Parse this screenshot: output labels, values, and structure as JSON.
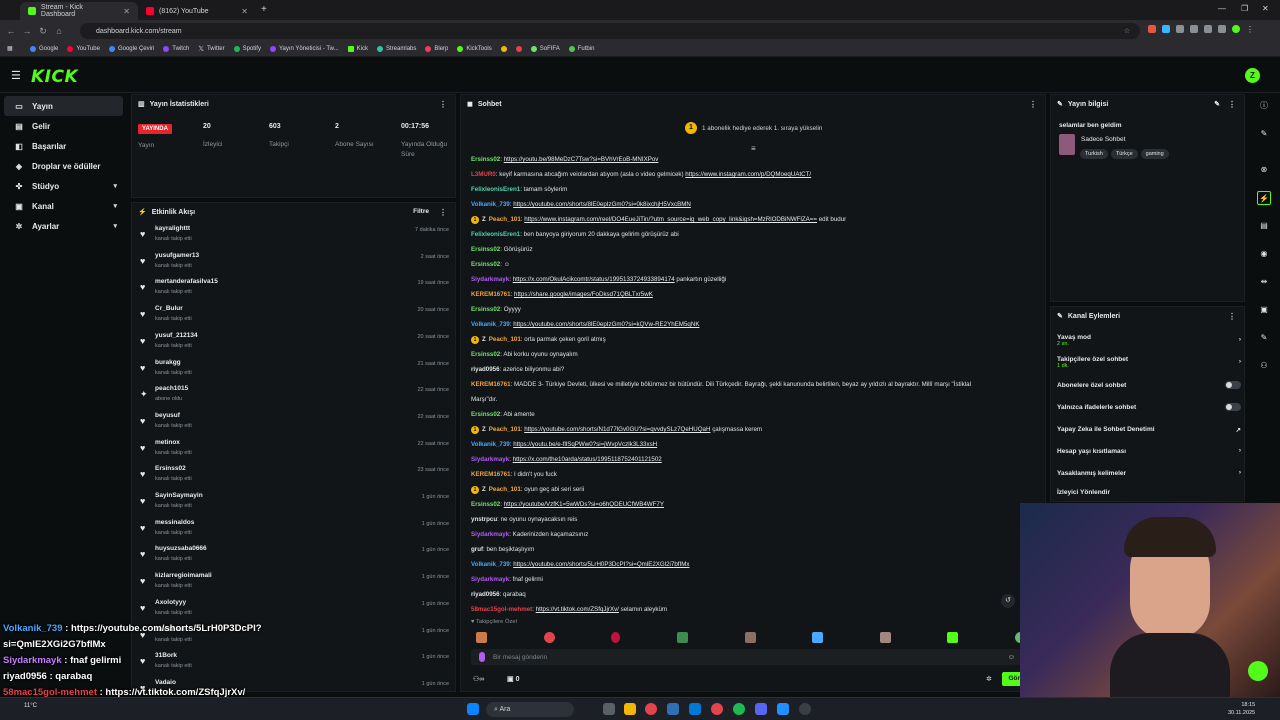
{
  "browser": {
    "tabs": [
      {
        "title": "Stream - Kick Dashboard",
        "color": "#53fc18"
      },
      {
        "title": "(8162) YouTube",
        "color": "#ff0033"
      }
    ],
    "url": "dashboard.kick.com/stream",
    "bookmarks": [
      "Google",
      "YouTube",
      "Google Çeviri",
      "Twitch",
      "Twitter",
      "Spotify",
      "Yayın Yöneticisi - Tw...",
      "Kick",
      "Streamlabs",
      "Blerp",
      "KickTools",
      "SoFIFA",
      "Futbin"
    ]
  },
  "header": {
    "logo": "KICK",
    "avatar_letter": "Z"
  },
  "sidebar": {
    "items": [
      {
        "label": "Yayın",
        "icon": "▭"
      },
      {
        "label": "Gelir",
        "icon": "▤"
      },
      {
        "label": "Başarılar",
        "icon": "◧"
      },
      {
        "label": "Droplar ve ödüller",
        "icon": "◈"
      },
      {
        "label": "Stüdyo",
        "icon": "✜"
      },
      {
        "label": "Kanal",
        "icon": "▣"
      },
      {
        "label": "Ayarlar",
        "icon": "✲"
      }
    ]
  },
  "stats": {
    "title": "Yayın İstatistikleri",
    "live_badge": "YAYINDA",
    "columns": [
      {
        "value": "",
        "label": "Yayın"
      },
      {
        "value": "20",
        "label": "İzleyici"
      },
      {
        "value": "603",
        "label": "Takipçi"
      },
      {
        "value": "2",
        "label": "Abone Sayısı"
      },
      {
        "value": "00:17:56",
        "label": "Yayında Olduğu Süre"
      }
    ]
  },
  "activity": {
    "title": "Etkinlik Akışı",
    "filter": "Filtre",
    "items": [
      {
        "name": "kayralighttt",
        "sub": "kanalı takip etti",
        "time": "7 dakika önce"
      },
      {
        "name": "yusufgamer13",
        "sub": "kanalı takip etti",
        "time": "2 saat önce"
      },
      {
        "name": "mertanderafasilva15",
        "sub": "kanalı takip etti",
        "time": "19 saat önce"
      },
      {
        "name": "Cr_Bulur",
        "sub": "kanalı takip etti",
        "time": "20 saat önce"
      },
      {
        "name": "yusuf_212134",
        "sub": "kanalı takip etti",
        "time": "20 saat önce"
      },
      {
        "name": "burakgg",
        "sub": "kanalı takip etti",
        "time": "21 saat önce"
      },
      {
        "name": "peach1015",
        "sub": "abone oldu",
        "time": "22 saat önce"
      },
      {
        "name": "beyusuf",
        "sub": "kanalı takip etti",
        "time": "22 saat önce"
      },
      {
        "name": "metinox",
        "sub": "kanalı takip etti",
        "time": "22 saat önce"
      },
      {
        "name": "Ersinss02",
        "sub": "kanalı takip etti",
        "time": "23 saat önce"
      },
      {
        "name": "SayinSaymayin",
        "sub": "kanalı takip etti",
        "time": "1 gün önce"
      },
      {
        "name": "messinaldos",
        "sub": "kanalı takip etti",
        "time": "1 gün önce"
      },
      {
        "name": "huysuzsaba0666",
        "sub": "kanalı takip etti",
        "time": "1 gün önce"
      },
      {
        "name": "kizlarregioimamali",
        "sub": "kanalı takip etti",
        "time": "1 gün önce"
      },
      {
        "name": "Axolotyyy",
        "sub": "kanalı takip etti",
        "time": "1 gün önce"
      },
      {
        "name": "saldaheal",
        "sub": "kanalı takip etti",
        "time": "1 gün önce"
      },
      {
        "name": "31Bork",
        "sub": "kanalı takip etti",
        "time": "1 gün önce"
      },
      {
        "name": "Vadaio",
        "sub": "kanalı takip etti",
        "time": "1 gün önce"
      }
    ]
  },
  "chat": {
    "title": "Sohbet",
    "gift_banner": "1 abonelik hediye ederek 1. sıraya yükselin",
    "messages": [
      {
        "user": "Ersinss02",
        "color": "#6fe36a",
        "badge": false,
        "text": "",
        "link": "https://youtu.be/98MeDzC7Tsw?si=BVhVrEoB-MNIXPov",
        "after": ""
      },
      {
        "user": "L3MUR0",
        "color": "#e2434c",
        "badge": false,
        "text": "keyif karmasına atıcağım veiolardan atıyom (asla o video gelmicek) ",
        "link": "https://www.instagram.com/p/DQMoeqUAtCT/",
        "after": ""
      },
      {
        "user": "FelixleonisEren1",
        "color": "#4ed6b0",
        "badge": false,
        "text": "tamam söylerim",
        "link": "",
        "after": ""
      },
      {
        "user": "Volkanik_739",
        "color": "#4aa8ff",
        "badge": false,
        "text": "",
        "link": "https://youtube.com/shorts/8lE0epIzGm0?si=0k8ixchjH5VxcBMN",
        "after": ""
      },
      {
        "user": "Peach_101",
        "color": "#f2a93b",
        "badge": true,
        "text": "",
        "link": "https://www.instagram.com/reel/DO4EueJiTin/?utm_source=ig_web_copy_link&igsh=MzRlODBiNWFlZA==",
        "after": " edit budur"
      },
      {
        "user": "FelixleonisEren1",
        "color": "#4ed6b0",
        "badge": false,
        "text": "ben banyoya giriyorum 20 dakkaya gelirim görüşürüz abi",
        "link": "",
        "after": ""
      },
      {
        "user": "Ersinss02",
        "color": "#6fe36a",
        "badge": false,
        "text": "Görüşürüz",
        "link": "",
        "after": ""
      },
      {
        "user": "Ersinss02",
        "color": "#6fe36a",
        "badge": false,
        "text": "☺",
        "link": "",
        "after": ""
      },
      {
        "user": "Siydarkmayk",
        "color": "#b05cf5",
        "badge": false,
        "text": "",
        "link": "https://x.com/OkulAcikcomtr/status/1995133724933894174",
        "after": " pankartın güzelliği"
      },
      {
        "user": "KEREM16761",
        "color": "#f0a23c",
        "badge": false,
        "text": "",
        "link": "https://share.google/images/FoDksd71QBLTxr5wK",
        "after": ""
      },
      {
        "user": "Ersinss02",
        "color": "#6fe36a",
        "badge": false,
        "text": "Oyyyy",
        "link": "",
        "after": ""
      },
      {
        "user": "Volkanik_739",
        "color": "#4aa8ff",
        "badge": false,
        "text": "",
        "link": "https://youtube.com/shorts/8lE0epIzGm0?si=kQVw-RE2YhEM5qNK",
        "after": ""
      },
      {
        "user": "Peach_101",
        "color": "#f2a93b",
        "badge": true,
        "text": "orta parmak çeken goril atmış",
        "link": "",
        "after": ""
      },
      {
        "user": "Ersinss02",
        "color": "#6fe36a",
        "badge": false,
        "text": "Abi korku oyunu oynayalım",
        "link": "",
        "after": ""
      },
      {
        "user": "riyad0956",
        "color": "#dfe3e6",
        "badge": false,
        "text": "azerice biliyonmu abi?",
        "link": "",
        "after": ""
      },
      {
        "user": "KEREM16761",
        "color": "#f0a23c",
        "badge": false,
        "text": "MADDE 3- Türkiye Devleti, ülkesi ve milletiyle bölünmez bir bütündür. Dili Türkçedir. Bayrağı, şekli kanununda belirtilen, beyaz ay yıldızlı al bayraktır. Millî marşı \"İstiklal",
        "link": "",
        "after": ""
      },
      {
        "user": "",
        "color": "#dfe3e6",
        "badge": false,
        "text": "Marşı\"dır.",
        "link": "",
        "after": ""
      },
      {
        "user": "Ersinss02",
        "color": "#6fe36a",
        "badge": false,
        "text": "Abi amente",
        "link": "",
        "after": ""
      },
      {
        "user": "Peach_101",
        "color": "#f2a93b",
        "badge": true,
        "text": "",
        "link": "https://youtube.com/shorts/N1d77lGv0GU?si=qvvdySLz7QeHUQaH",
        "after": " çalışmassa kerem"
      },
      {
        "user": "Volkanik_739",
        "color": "#4aa8ff",
        "badge": false,
        "text": "",
        "link": "https://youtu.be/e-fllSqPWw0?si=jWvpVczlk3L33xsH",
        "after": ""
      },
      {
        "user": "Siydarkmayk",
        "color": "#b05cf5",
        "badge": false,
        "text": "",
        "link": "https://x.com/the10arda/status/1995118752401121502",
        "after": ""
      },
      {
        "user": "KEREM16761",
        "color": "#f0a23c",
        "badge": false,
        "text": "I didn't you fuck",
        "link": "",
        "after": ""
      },
      {
        "user": "Peach_101",
        "color": "#f2a93b",
        "badge": true,
        "text": "oyun geç abi seri serii",
        "link": "",
        "after": ""
      },
      {
        "user": "Ersinss02",
        "color": "#6fe36a",
        "badge": false,
        "text": "",
        "link": "https://youtube/VzfK1=5wWDs?si=o6hQDEUCfWB4WF7Y",
        "after": ""
      },
      {
        "user": "ynstrpcu",
        "color": "#dfe3e6",
        "badge": false,
        "text": "ne oyunu oynayacaksın reis",
        "link": "",
        "after": ""
      },
      {
        "user": "Siydarkmayk",
        "color": "#b05cf5",
        "badge": false,
        "text": "Kaderinizden kaçamazsınız",
        "link": "",
        "after": ""
      },
      {
        "user": "gruf",
        "color": "#dfe3e6",
        "badge": false,
        "text": "ben beşiktaşlıyım",
        "link": "",
        "after": ""
      },
      {
        "user": "Volkanik_739",
        "color": "#4aa8ff",
        "badge": false,
        "text": "",
        "link": "https://youtube.com/shorts/5LrH0P3DcPI?si=QmlE2XGl2i7bfIMx",
        "after": ""
      },
      {
        "user": "Siydarkmayk",
        "color": "#b05cf5",
        "badge": false,
        "text": "fnaf gelirmi",
        "link": "",
        "after": ""
      },
      {
        "user": "riyad0956",
        "color": "#dfe3e6",
        "badge": false,
        "text": "qarabaq",
        "link": "",
        "after": ""
      },
      {
        "user": "58mac15gol-mehmet",
        "color": "#e2434c",
        "badge": false,
        "text": "",
        "link": "https://vt.tiktok.com/ZSfqJjrXv/",
        "after": " selamın aleyküm"
      }
    ],
    "followers_only": "Takipçilere Özel",
    "input_placeholder": "Bir mesaj gönderin",
    "points": "0",
    "send": "Gönder"
  },
  "info": {
    "title": "Yayın bilgisi",
    "stream_title": "selamlar ben geldim",
    "category": "Sadece Sohbet",
    "tags": [
      "Turkish",
      "Türkçe",
      "gaming"
    ]
  },
  "actions": {
    "title": "Kanal Eylemleri",
    "items": [
      {
        "label": "Yavaş mod",
        "sub": "2 sn.",
        "control": "chevron"
      },
      {
        "label": "Takipçilere özel sohbet",
        "sub": "1 dk.",
        "control": "chevron"
      },
      {
        "label": "Abonelere özel sohbet",
        "sub": "",
        "control": "toggle"
      },
      {
        "label": "Yalnızca ifadelerle sohbet",
        "sub": "",
        "control": "toggle"
      },
      {
        "label": "Yapay Zeka ile Sohbet Denetimi",
        "sub": "",
        "control": "external"
      },
      {
        "label": "Hesap yaşı kısıtlaması",
        "sub": "",
        "control": "chevron"
      },
      {
        "label": "Yasaklanmış kelimeler",
        "sub": "",
        "control": "chevron"
      },
      {
        "label": "İzleyici Yönlendir",
        "sub": "",
        "control": "none"
      }
    ]
  },
  "overlay": {
    "lines": [
      {
        "user": "Volkanik_739",
        "color": "#4aa8ff",
        "text": " : https://youtube.com/shorts/5LrH0P3DcPI?"
      },
      {
        "user": "",
        "color": "#ffffff",
        "text": "si=QmlE2XGi2G7bfIMx"
      },
      {
        "user": "Siydarkmayk",
        "color": "#c77dff",
        "text": " : fnaf gelirmi"
      },
      {
        "user": "riyad0956",
        "color": "#ffffff",
        "text": " : qarabaq"
      },
      {
        "user": "58mac15gol-mehmet",
        "color": "#e2434c",
        "text": " : https://vt.tiktok.com/ZSfqJjrXv/"
      },
      {
        "user": "",
        "color": "#ffffff",
        "text": "selamın aleyküm"
      }
    ]
  },
  "taskbar": {
    "search": "Ara",
    "weather": "11°C",
    "time": "18:15",
    "date": "30.11.2025"
  }
}
